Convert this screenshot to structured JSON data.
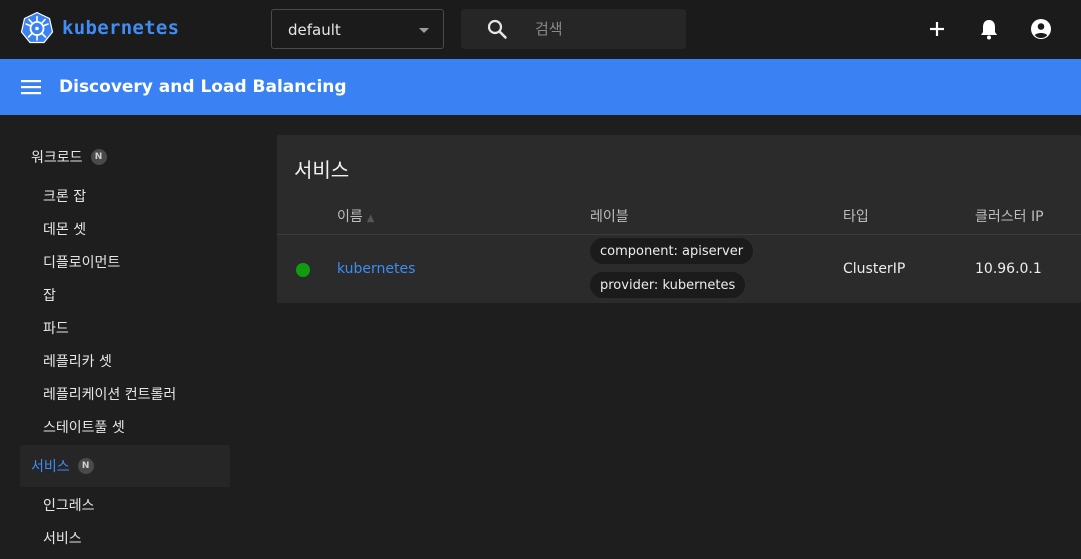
{
  "app": {
    "brand": "kubernetes"
  },
  "namespace": {
    "value": "default"
  },
  "search": {
    "placeholder": "검색"
  },
  "header": {
    "title": "Discovery and Load Balancing"
  },
  "sidebar": {
    "groups": [
      {
        "label": "워크로드",
        "badge": "N"
      },
      {
        "label": "서비스",
        "badge": "N"
      }
    ],
    "workload_items": [
      "크론 잡",
      "데몬 셋",
      "디플로이먼트",
      "잡",
      "파드",
      "레플리카 셋",
      "레플리케이션 컨트롤러",
      "스테이트풀 셋"
    ],
    "service_items": [
      "인그레스",
      "서비스"
    ]
  },
  "card": {
    "title": "서비스",
    "columns": [
      "이름",
      "레이블",
      "타입",
      "클러스터 IP"
    ],
    "rows": [
      {
        "name": "kubernetes",
        "labels": [
          "component: apiserver",
          "provider: kubernetes"
        ],
        "type": "ClusterIP",
        "cluster_ip": "10.96.0.1",
        "status_color": "#0f9d0f"
      }
    ]
  },
  "colors": {
    "accent": "#3a82f4",
    "link": "#3f8cf4",
    "status_ok": "#0f9d0f"
  }
}
